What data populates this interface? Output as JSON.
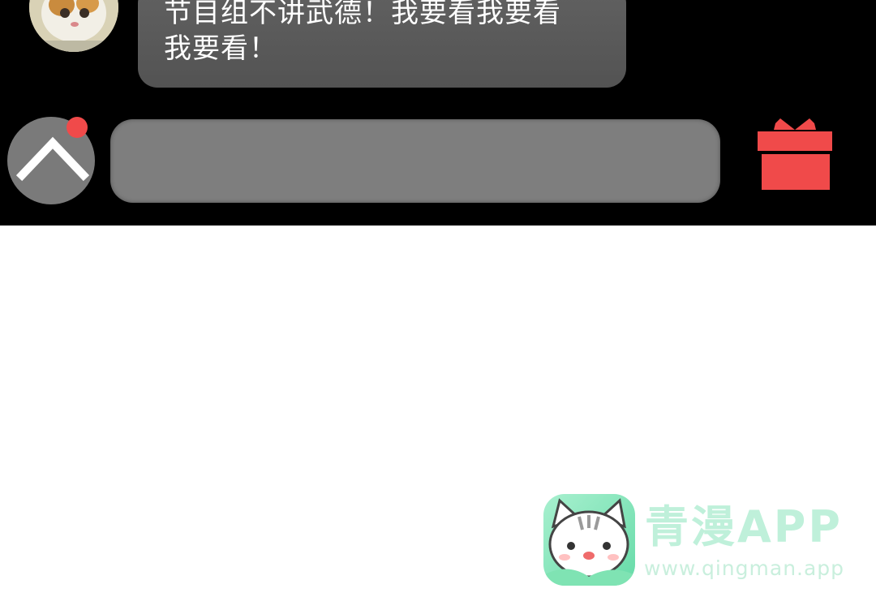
{
  "comment": {
    "avatar_icon": "cat-avatar",
    "text": "节目组不讲武德！我要看我要看我要看！"
  },
  "composer": {
    "expand_icon": "chevron-up-icon",
    "has_notification": true,
    "input_value": "",
    "gift_icon": "gift-icon"
  },
  "watermark": {
    "logo_icon": "cat-logo-icon",
    "title": "青漫APP",
    "url": "www.qingman.app"
  },
  "colors": {
    "panel_bg": "#000000",
    "bubble_bg": "#5a5a5a",
    "input_bg": "#7e7e7e",
    "notification": "#f04a4a",
    "gift": "#f04a4a",
    "watermark": "#bff0da"
  }
}
